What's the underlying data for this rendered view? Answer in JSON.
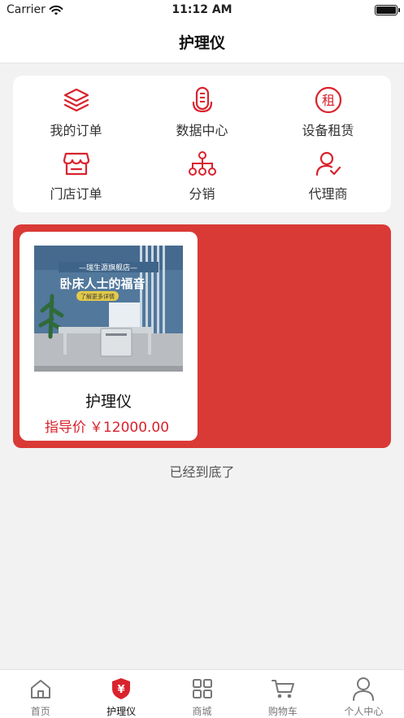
{
  "status_bar": {
    "carrier": "Carrier",
    "time": "11:12 AM"
  },
  "nav": {
    "title": "护理仪"
  },
  "menu": {
    "items": [
      {
        "label": "我的订单",
        "icon": "layers-icon"
      },
      {
        "label": "数据中心",
        "icon": "microphone-icon"
      },
      {
        "label": "设备租赁",
        "icon": "rent-icon"
      },
      {
        "label": "门店订单",
        "icon": "store-icon"
      },
      {
        "label": "分销",
        "icon": "network-icon"
      },
      {
        "label": "代理商",
        "icon": "agent-user-icon"
      }
    ]
  },
  "product": {
    "image_banner": "—瑞生源旗舰店—",
    "image_headline": "卧床人士的福音",
    "image_badge": "了解更多详情",
    "image_brand": "",
    "name": "护理仪",
    "price_prefix": "指导价",
    "price": "￥12000.00"
  },
  "end_text": "已经到底了",
  "tabs": [
    {
      "label": "首页",
      "icon": "home-icon",
      "active": false
    },
    {
      "label": "护理仪",
      "icon": "shield-yen-icon",
      "active": true
    },
    {
      "label": "商城",
      "icon": "grid-icon",
      "active": false
    },
    {
      "label": "购物车",
      "icon": "cart-icon",
      "active": false
    },
    {
      "label": "个人中心",
      "icon": "user-icon",
      "active": false
    }
  ],
  "colors": {
    "accent": "#d9232d",
    "panel": "#d93a36",
    "background": "#f2f2f2"
  }
}
